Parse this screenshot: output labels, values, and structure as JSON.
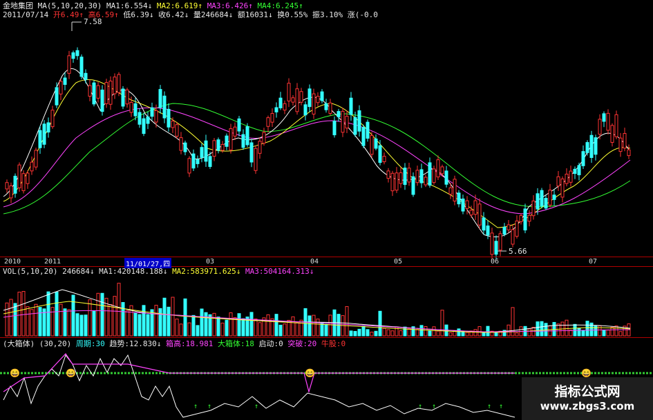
{
  "header": {
    "stock_name": "金地集团",
    "ma_params": "MA(5,10,20,30)",
    "ma1": "MA1:6.554↓",
    "ma2": "MA2:6.619↑",
    "ma3": "MA3:6.426↑",
    "ma4": "MA4:6.245↑",
    "date": "2011/07/14",
    "open": "开6.49↑",
    "high": "高6.59↑",
    "low": "低6.39↓",
    "close": "收6.42↓",
    "volume": "量246684↓",
    "amount": "额16031↓",
    "turnover": "换0.55%",
    "amplitude": "振3.10%",
    "change": "涨(-0.0"
  },
  "price_labels": {
    "peak": "7.58",
    "trough": "5.66"
  },
  "axis": {
    "y2010": "2010",
    "y2011": "2011",
    "cursor_date": "11/01/27,四",
    "m03": "03",
    "m04": "04",
    "m05": "05",
    "m06": "06",
    "m07": "07"
  },
  "vol_header": {
    "params": "VOL(5,10,20)",
    "value": "246684↓",
    "ma1": "MA1:420148.188↓",
    "ma2": "MA2:583971.625↓",
    "ma3": "MA3:504164.313↓"
  },
  "ind_header": {
    "name": "(大箱体)",
    "params": "(30,20)",
    "period": "周期:30",
    "trend": "趋势:12.830↓",
    "box_high": "箱高:18.981",
    "big_box": "大箱体:18",
    "start": "启动:0",
    "breakout": "突破:20",
    "bull": "牛股:0"
  },
  "watermark": {
    "title": "指标公式网",
    "url": "www.zbgs3.com"
  },
  "colors": {
    "up": "#ff3333",
    "down": "#33ffff",
    "ma1": "#ffffff",
    "ma2": "#ffff33",
    "ma3": "#ff44ff",
    "ma4": "#33ff33"
  }
}
